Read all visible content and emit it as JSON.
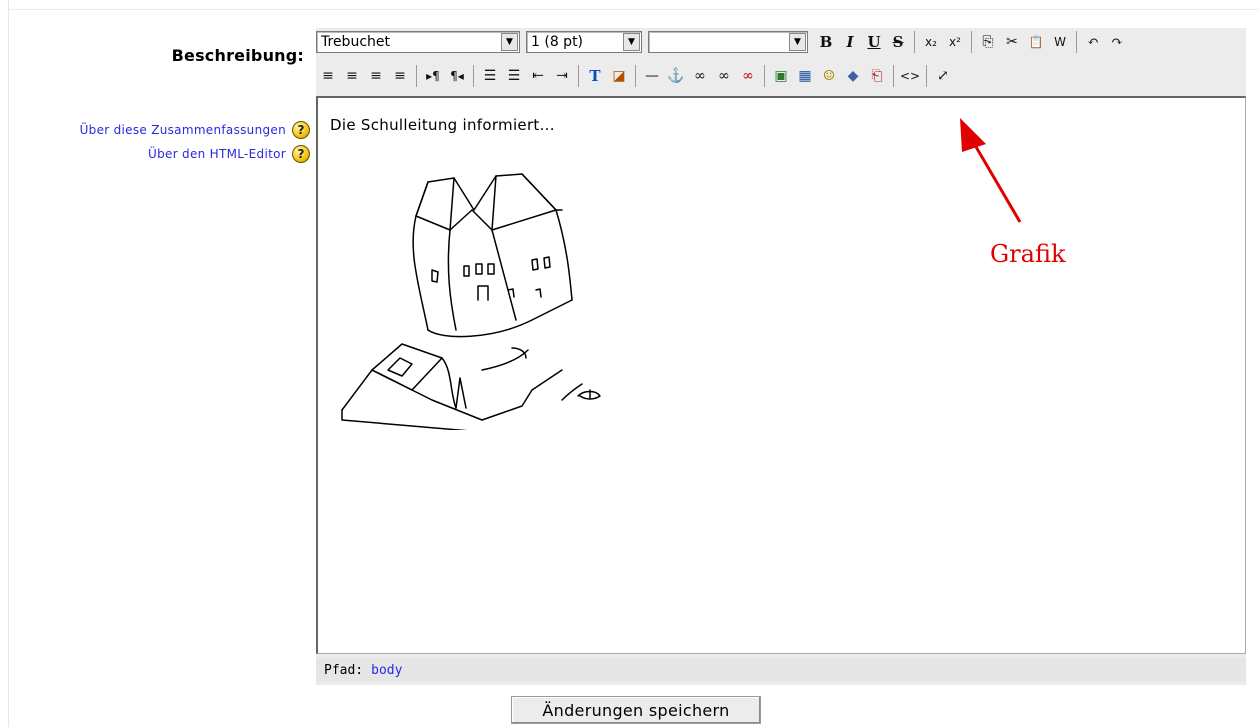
{
  "form": {
    "description_label": "Beschreibung:",
    "help_summary_link": "Über diese Zusammenfassungen",
    "help_editor_link": "Über den HTML-Editor",
    "help_icon_glyph": "?",
    "save_button": "Änderungen speichern"
  },
  "toolbar": {
    "font_family": "Trebuchet",
    "font_size": "1 (8 pt)",
    "format": "",
    "bold": "B",
    "italic": "I",
    "underline": "U",
    "strikethrough": "S",
    "subscript": "x₂",
    "superscript": "x²",
    "copy": "⎘",
    "cut": "✂",
    "paste": "📋",
    "paste_word": "W",
    "undo": "↶",
    "redo": "↷",
    "align_left": "≡",
    "align_center": "≡",
    "align_right": "≡",
    "justify": "≡",
    "ltr": "▸¶",
    "rtl": "¶◂",
    "ordered_list": "☰",
    "unordered_list": "☰",
    "outdent": "⇤",
    "indent": "⇥",
    "text_color": "T",
    "background_color": "◪",
    "horizontal_rule": "—",
    "anchor": "⚓",
    "link": "∞",
    "unlink": "∞",
    "nolink": "∞",
    "image": "▣",
    "table": "▦",
    "smiley": "☺",
    "special_char": "◆",
    "search_replace": "⎗",
    "html_source": "<>",
    "fullscreen": "⤢"
  },
  "editor": {
    "content_text": "Die Schulleitung informiert...",
    "path_label": "Pfad:",
    "path_value": "body"
  },
  "annotation": {
    "label": "Grafik",
    "color": "#e00000"
  }
}
